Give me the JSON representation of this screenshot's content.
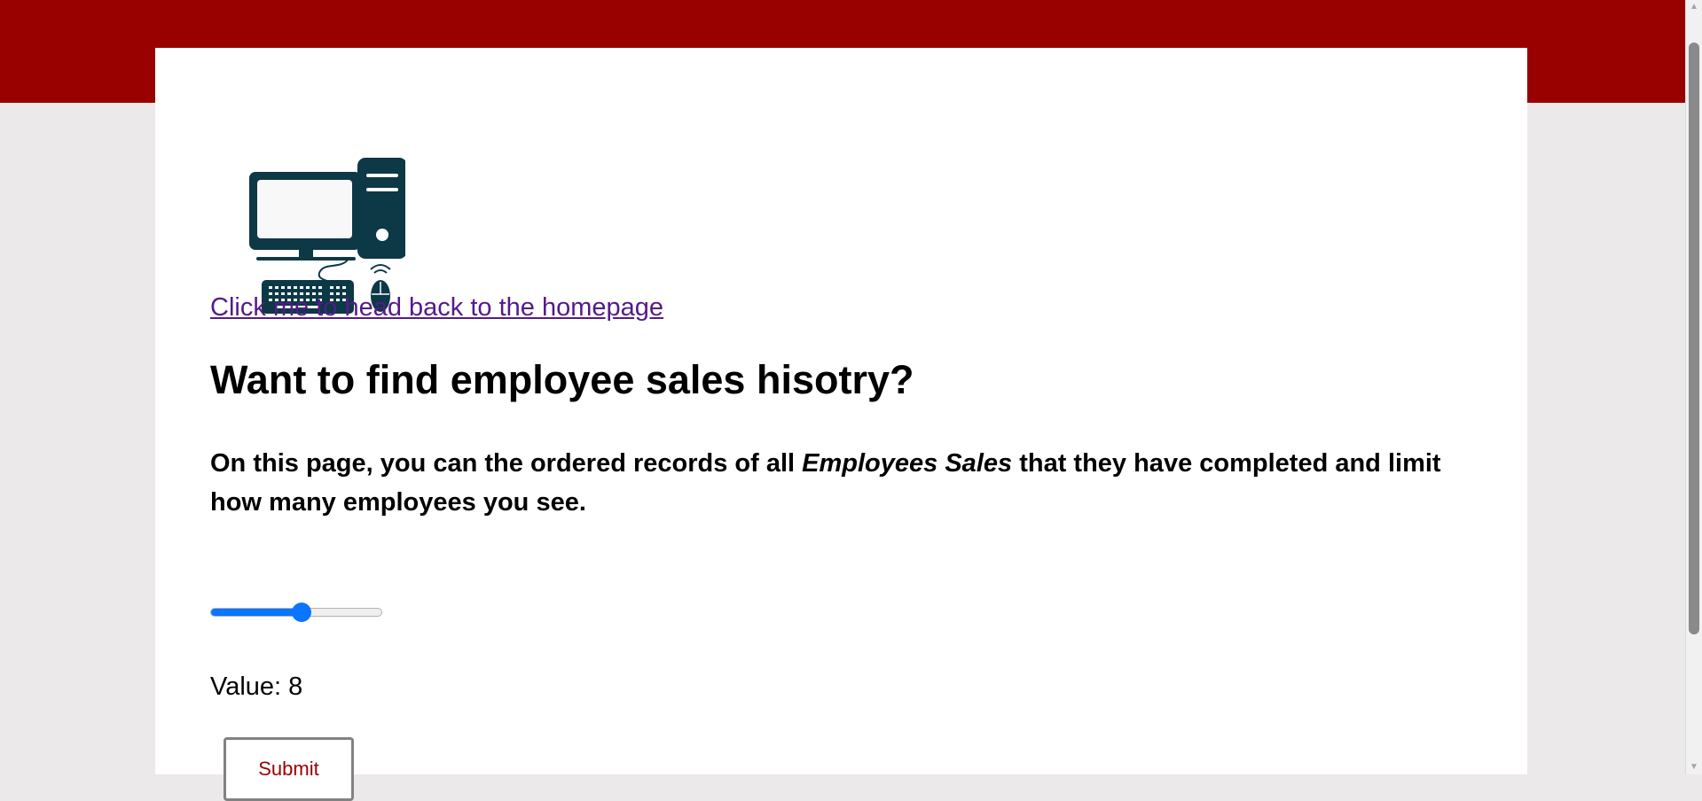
{
  "nav": {
    "home_link": "Click me to head back to the homepage"
  },
  "main": {
    "title": "Want to find employee sales hisotry?",
    "intro_before": "On this page, you can the ordered records of all ",
    "intro_emphasis": "Employees Sales",
    "intro_after": " that they have completed and limit how many employees you see.",
    "value_label": "Value: ",
    "value": "8",
    "submit_label": "Submit"
  },
  "slider": {
    "value": 8,
    "min": 0,
    "max": 15
  },
  "logo": {
    "icon": "desktop-computer-icon"
  },
  "colors": {
    "accent": "#990000",
    "slider": "#0a75ff",
    "link": "#551a8b",
    "logo": "#0d3846",
    "background": "#ebe9ea"
  }
}
